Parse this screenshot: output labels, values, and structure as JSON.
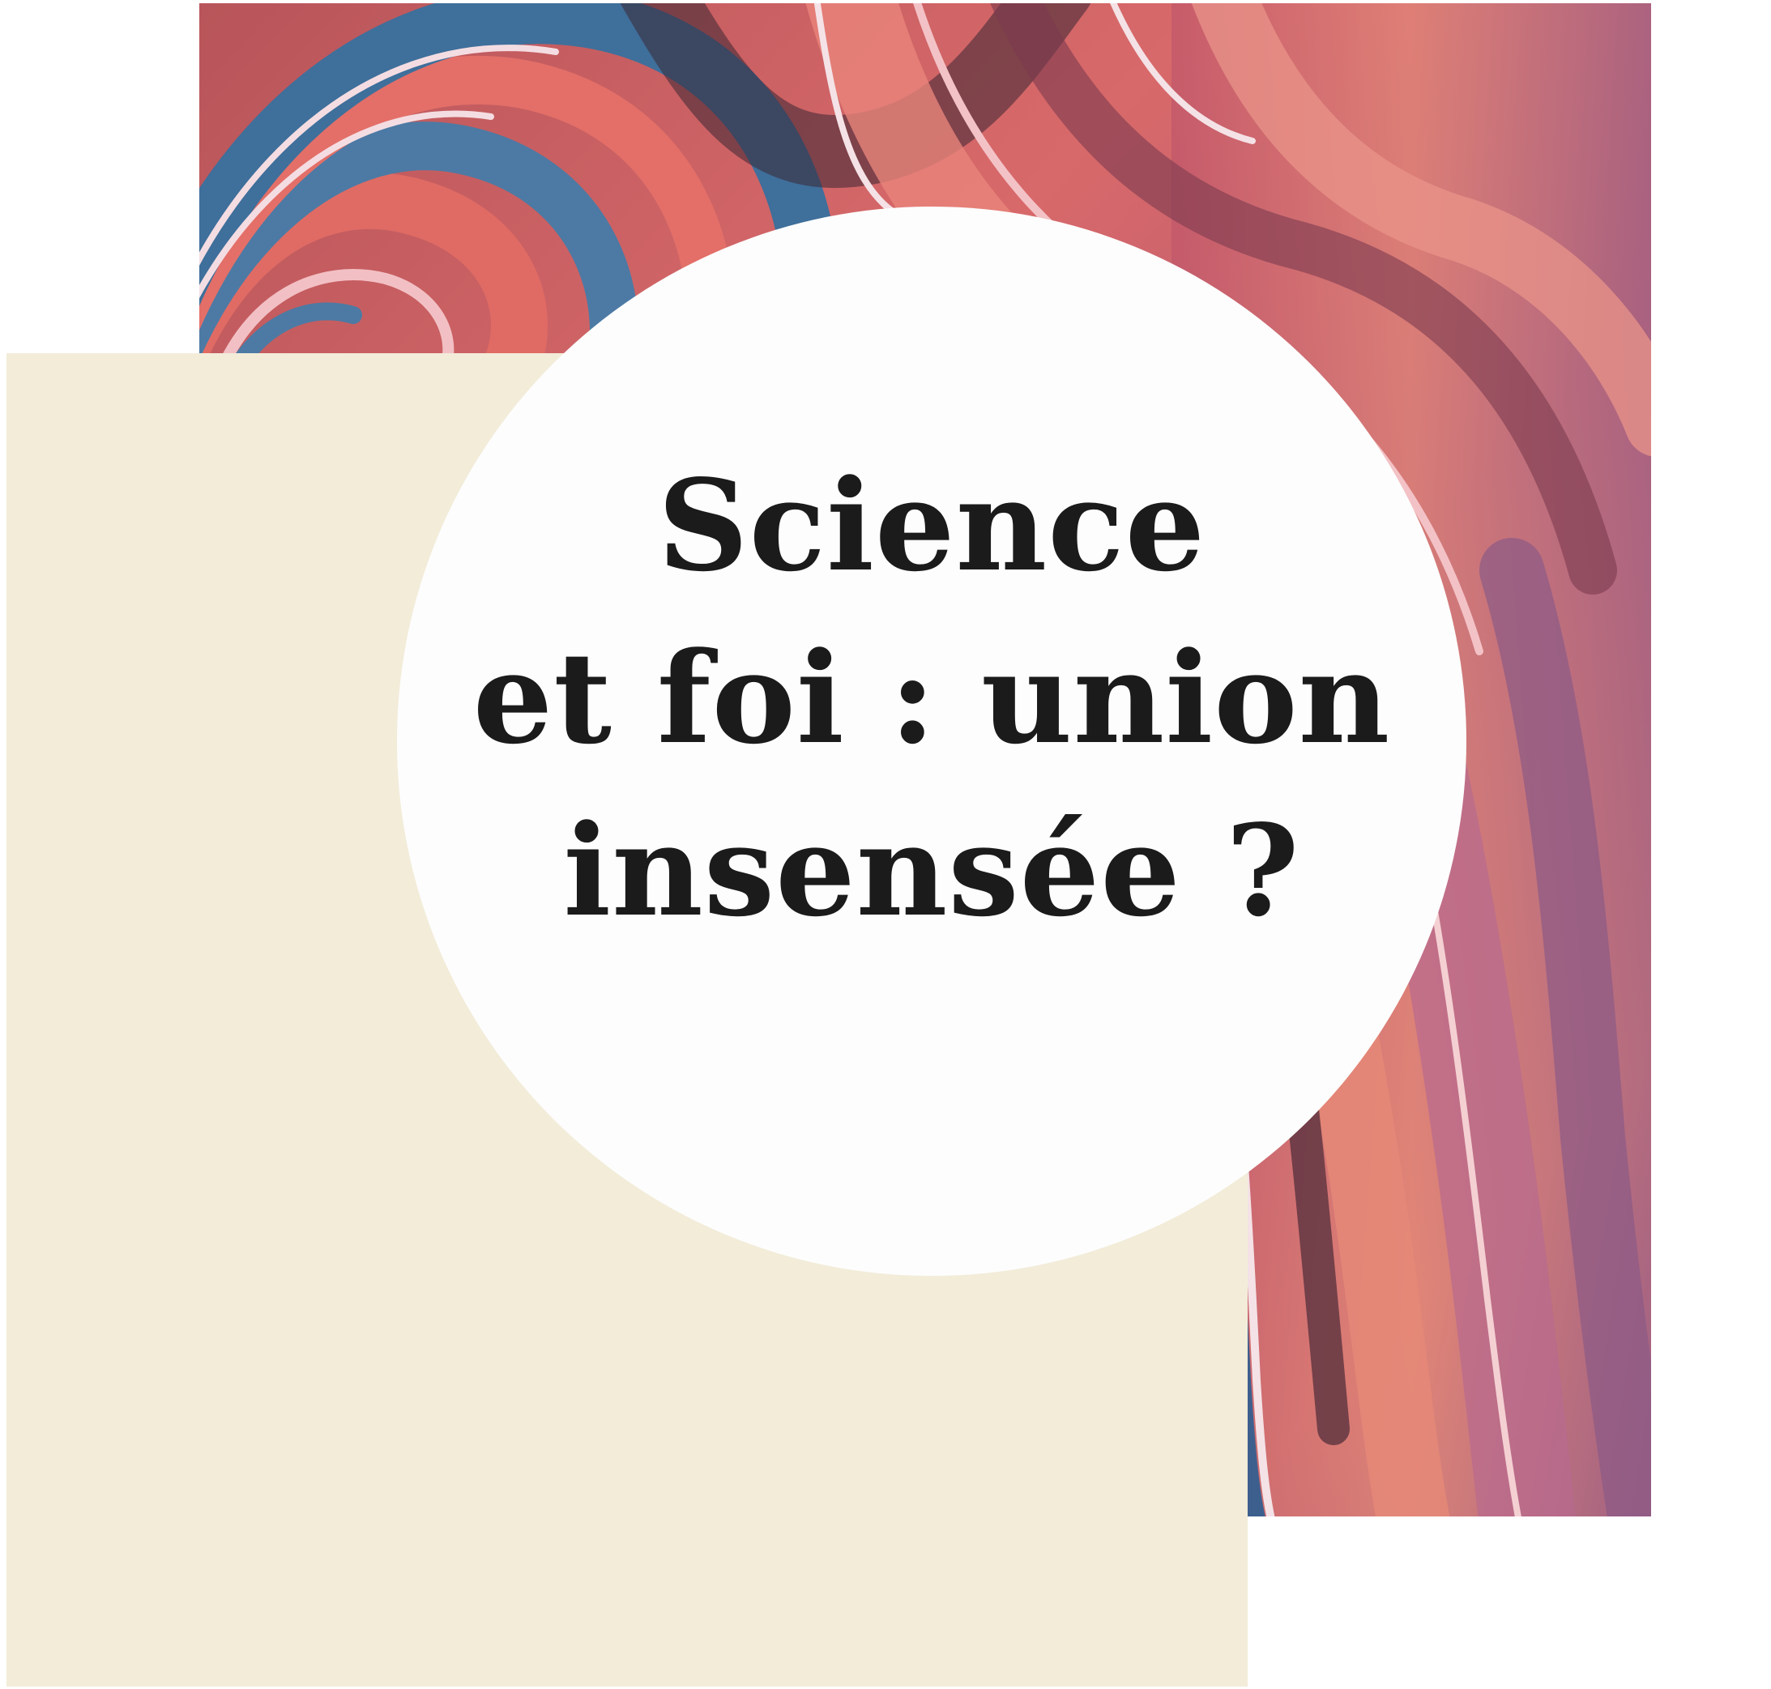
{
  "title_lines": [
    "Science",
    "et foi : union",
    "insensée ?"
  ],
  "colors": {
    "page_background": "#ffffff",
    "cream_panel": "#f2ecd9",
    "circle": "#fdfdfd",
    "title_text": "#1b1b1b",
    "marble_coral": "#e07066",
    "marble_blue": "#4e7ea6",
    "marble_mauve": "#9a5f7e",
    "marble_dark": "#3a2633"
  },
  "background_image": "abstract-marbled-paint-texture"
}
